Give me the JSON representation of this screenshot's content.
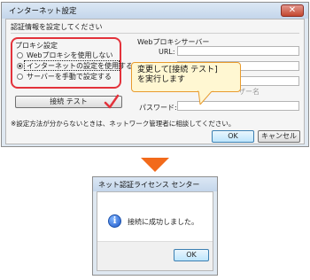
{
  "window1": {
    "title": "インターネット設定",
    "close_label": "✕",
    "section_title": "認証情報を設定してください",
    "proxy_group_title": "プロキシ設定",
    "proxy_options": [
      "Webプロキシを使用しない",
      "インターネットの設定を使用する",
      "サーバーを手動で設定する"
    ],
    "selected_option_index": 1,
    "test_button_label": "接続 テスト",
    "web_proxy_server_title": "Webプロキシサーバー",
    "fields": {
      "url_label": "URL:",
      "user_name_label_partial": "ザー名",
      "password_label": "パスワード:"
    },
    "note": "※設定方法が分からないときは、ネットワーク管理者に相談してください。",
    "ok_label": "OK",
    "cancel_label": "キャンセル"
  },
  "callout": {
    "text_line1": "変更して[接続 テスト]",
    "text_line2": "を実行します"
  },
  "window2": {
    "title": "ネット認証ライセンス センター",
    "message": "接続に成功しました。",
    "ok_label": "OK"
  },
  "colors": {
    "highlight_red": "#e3323b",
    "arrow_orange": "#f26a1b",
    "callout_border": "#e89b2e",
    "callout_bg": "#fff7d2"
  }
}
